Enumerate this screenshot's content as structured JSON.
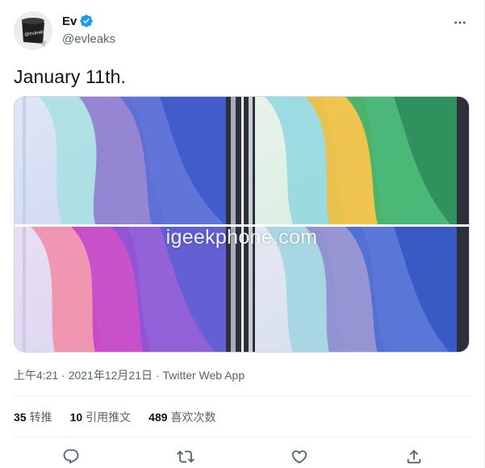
{
  "author": {
    "name": "Ev",
    "handle": "@evleaks",
    "avatar_text": "@evleaks"
  },
  "tweet": {
    "text": "January 11th.",
    "watermark": "igeekphone.com",
    "timestamp": "上午4:21 · 2021年12月21日",
    "source": "Twitter Web App"
  },
  "stats": {
    "retweets_count": "35",
    "retweets_label": "转推",
    "quotes_count": "10",
    "quotes_label": "引用推文",
    "likes_count": "489",
    "likes_label": "喜欢次数"
  },
  "icons": {
    "more": "more-horizontal-icon",
    "verified": "verified-badge-icon",
    "reply": "reply-icon",
    "retweet": "retweet-icon",
    "like": "heart-icon",
    "share": "share-icon"
  },
  "colors": {
    "accent": "#1d9bf0",
    "text_primary": "#0f1419",
    "text_secondary": "#536471",
    "border": "#eff3f4"
  }
}
